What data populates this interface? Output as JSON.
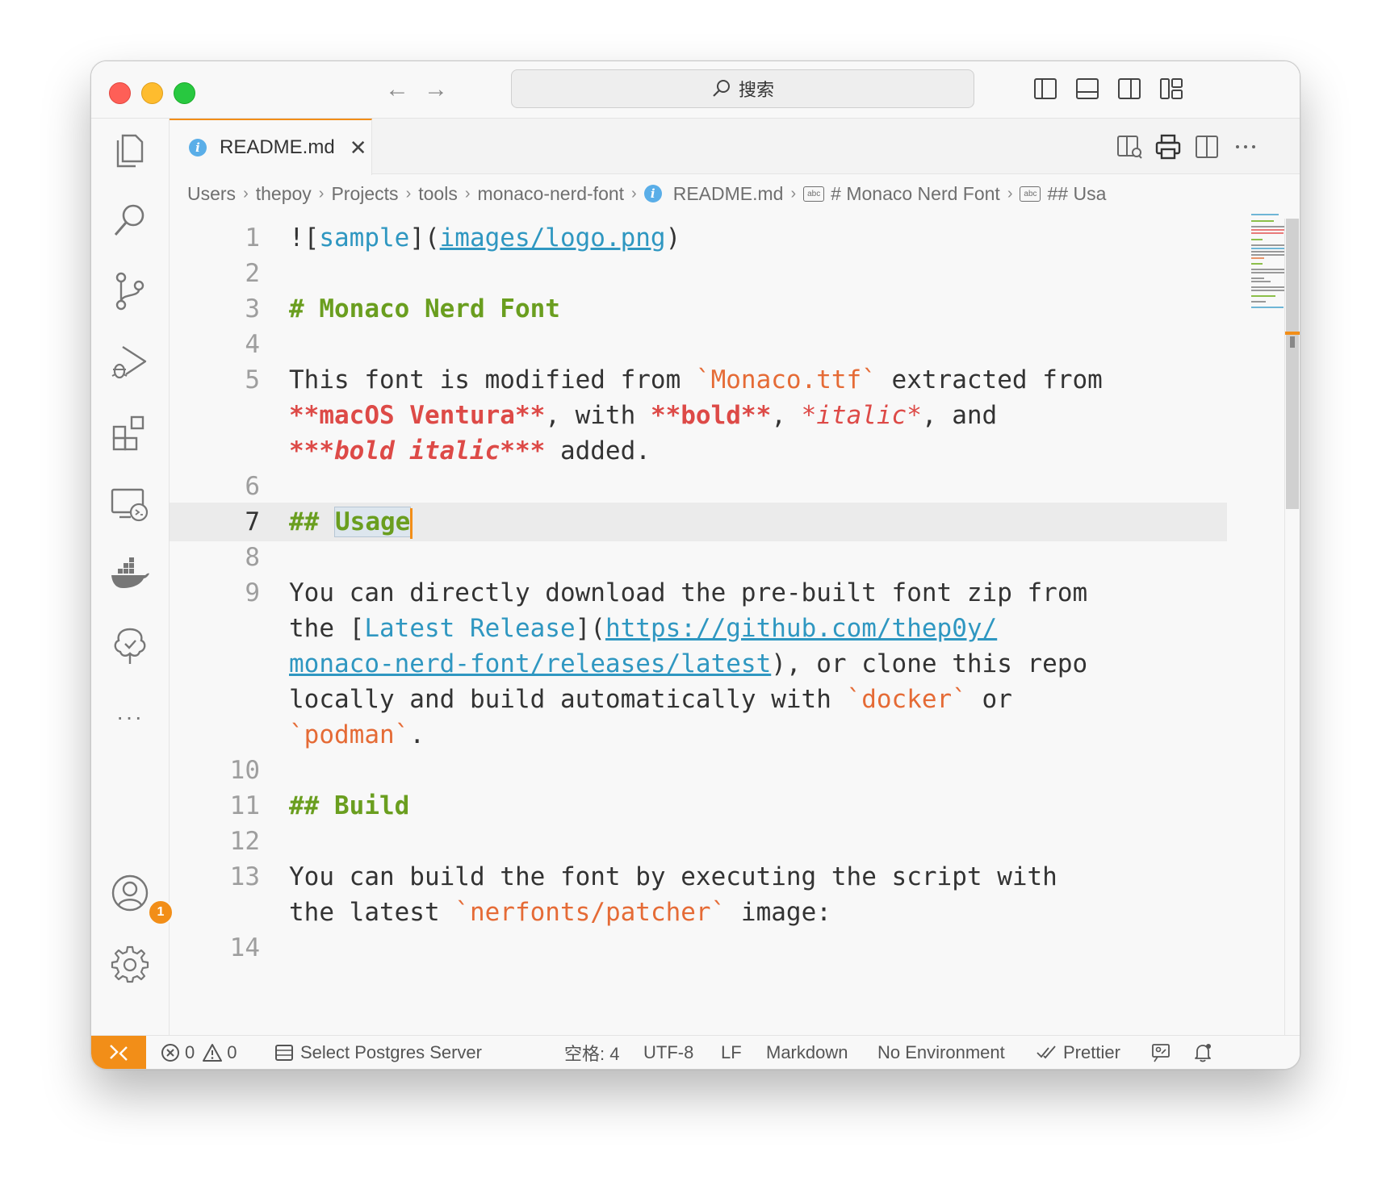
{
  "titlebar": {
    "back_label": "←",
    "forward_label": "→",
    "search_text": "搜索"
  },
  "tab": {
    "filename": "README.md",
    "close_glyph": "✕",
    "info_glyph": "i"
  },
  "breadcrumb": {
    "items": [
      "Users",
      "thepoy",
      "Projects",
      "tools",
      "monaco-nerd-font",
      "README.md",
      "# Monaco Nerd Font",
      "## Usa"
    ],
    "separator": "›",
    "abc_label": "abc"
  },
  "editor": {
    "line_numbers": [
      "1",
      "2",
      "3",
      "4",
      "5",
      "6",
      "7",
      "8",
      "9",
      "10",
      "11",
      "12",
      "13",
      "14"
    ],
    "l1": {
      "bang": "![",
      "alt": "sample",
      "mid": "](",
      "url": "images/logo.png",
      "end": ")"
    },
    "l3": "# Monaco Nerd Font",
    "l5a": {
      "t1": "This font is modified from ",
      "code": "`Monaco.ttf`",
      "t2": " extracted from"
    },
    "l5b": {
      "b1": "**macOS Ventura**",
      "t1": ", with ",
      "b2": "**bold**",
      "t2": ", ",
      "i1": "*italic*",
      "t3": ", and"
    },
    "l5c": {
      "bi": "***bold italic***",
      "t1": " added."
    },
    "l7": {
      "hash": "##",
      "word": "Usage"
    },
    "l9a": "You can directly download the pre-built font zip from",
    "l9b": {
      "t1": "the [",
      "link": "Latest Release",
      "t2": "](",
      "url": "https://github.com/thep0y/"
    },
    "l9c": {
      "url": "monaco-nerd-font/releases/latest",
      "t1": "), or clone this repo"
    },
    "l9d": {
      "t1": "locally and build automatically with ",
      "code": "`docker`",
      "t2": " or"
    },
    "l9e": {
      "code": "`podman`",
      "t1": "."
    },
    "l11": "## Build",
    "l13a": "You can build the font by executing the script with",
    "l13b": {
      "t1": "the latest ",
      "code": "`nerfonts/patcher`",
      "t2": " image:"
    }
  },
  "activity": {
    "accounts_badge": "1",
    "more_label": "···"
  },
  "status": {
    "errors": "0",
    "warnings": "0",
    "postgres": "Select Postgres Server",
    "indent": "空格: 4",
    "encoding": "UTF-8",
    "eol": "LF",
    "language": "Markdown",
    "environment": "No Environment",
    "prettier": "Prettier"
  },
  "colors": {
    "accent": "#f28e18",
    "heading": "#6a9e1f",
    "link": "#2f97c1",
    "code": "#e56b36",
    "emphasis": "#dd4a47"
  }
}
